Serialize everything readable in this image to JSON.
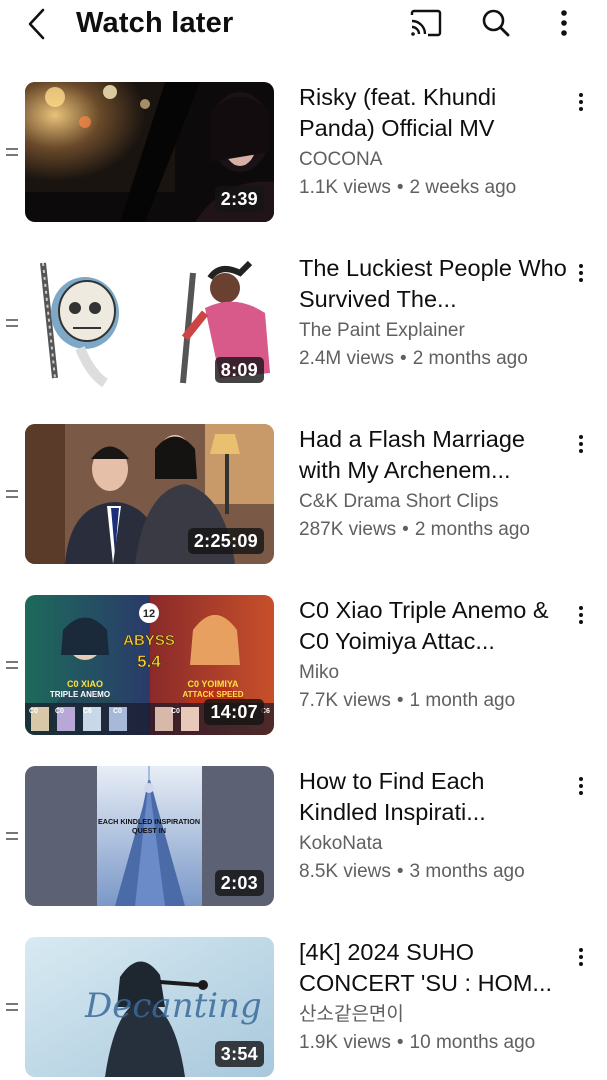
{
  "header": {
    "title": "Watch later",
    "icons": [
      "back-arrow-icon",
      "cast-icon",
      "search-icon",
      "more-vert-icon"
    ]
  },
  "videos": [
    {
      "title": "Risky (feat. Khundi Panda) Official MV",
      "channel": "COCONA",
      "views": "1.1K views",
      "age": "2 weeks ago",
      "duration": "2:39"
    },
    {
      "title": "The Luckiest People Who Survived The...",
      "channel": "The Paint Explainer",
      "views": "2.4M views",
      "age": "2 months ago",
      "duration": "8:09"
    },
    {
      "title": "Had a Flash Marriage with My Archenem...",
      "channel": "C&K Drama Short Clips",
      "views": "287K views",
      "age": "2 months ago",
      "duration": "2:25:09"
    },
    {
      "title": "C0 Xiao Triple Anemo & C0 Yoimiya Attac...",
      "channel": "Miko",
      "views": "7.7K views",
      "age": "1 month ago",
      "duration": "14:07",
      "thumb_text": {
        "badge": "12",
        "abyss": "ABYSS",
        "version": "5.4",
        "left_label_1": "C0 XIAO",
        "left_label_2": "TRIPLE ANEMO",
        "right_label_1": "C0 YOIMIYA",
        "right_label_2": "ATTACK SPEED",
        "cons": [
          "C0",
          "C0",
          "C6",
          "C0",
          "C0",
          "C6"
        ]
      }
    },
    {
      "title": "How to Find Each Kindled Inspirati...",
      "channel": "KokoNata",
      "views": "8.5K views",
      "age": "3 months ago",
      "duration": "2:03",
      "thumb_text": {
        "line1": "EACH KINDLED INSPIRATION",
        "line2": "QUEST IN"
      }
    },
    {
      "title": "[4K] 2024 SUHO CONCERT 'SU : HOM...",
      "channel": "산소같은면이",
      "views": "1.9K views",
      "age": "10 months ago",
      "duration": "3:54",
      "thumb_text": {
        "script": "Decanting"
      }
    }
  ],
  "colors": {
    "text_primary": "#0f0f0f",
    "text_secondary": "#606060",
    "duration_badge_bg": "#141414"
  }
}
